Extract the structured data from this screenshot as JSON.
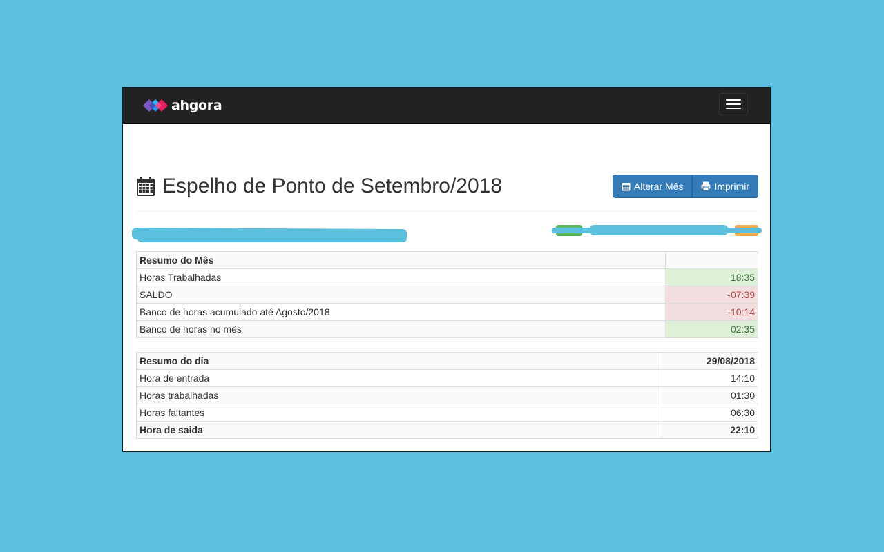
{
  "navbar": {
    "brand": "ahgora",
    "menu_icon": "hamburger-menu-icon"
  },
  "header": {
    "icon": "calendar-icon",
    "title": "Espelho de Ponto de Setembro/2018",
    "buttons": {
      "alterar_mes": "Alterar Mês",
      "imprimir": "Imprimir"
    }
  },
  "colors": {
    "page_background": "#5bc0de",
    "navbar": "#222222",
    "primary": "#337ab7",
    "success_bg": "#dff0d8",
    "success_text": "#3c763d",
    "danger_bg": "#f2dede",
    "danger_text": "#a94442",
    "label_green": "#5cb85c",
    "label_orange": "#f0ad4e"
  },
  "resumo_mes": {
    "header": "Resumo do Mês",
    "rows": [
      {
        "label": "Horas Trabalhadas",
        "value": "18:35",
        "status": "success"
      },
      {
        "label": "SALDO",
        "value": "-07:39",
        "status": "danger"
      },
      {
        "label": "Banco de horas acumulado até Agosto/2018",
        "value": "-10:14",
        "status": "danger"
      },
      {
        "label": "Banco de horas no mês",
        "value": "02:35",
        "status": "success"
      }
    ]
  },
  "resumo_dia": {
    "header": "Resumo do dia",
    "date": "29/08/2018",
    "rows": [
      {
        "label": "Hora de entrada",
        "value": "14:10"
      },
      {
        "label": "Horas trabalhadas",
        "value": "01:30"
      },
      {
        "label": "Horas faltantes",
        "value": "06:30"
      },
      {
        "label": "Hora de saida",
        "value": "22:10"
      }
    ]
  }
}
